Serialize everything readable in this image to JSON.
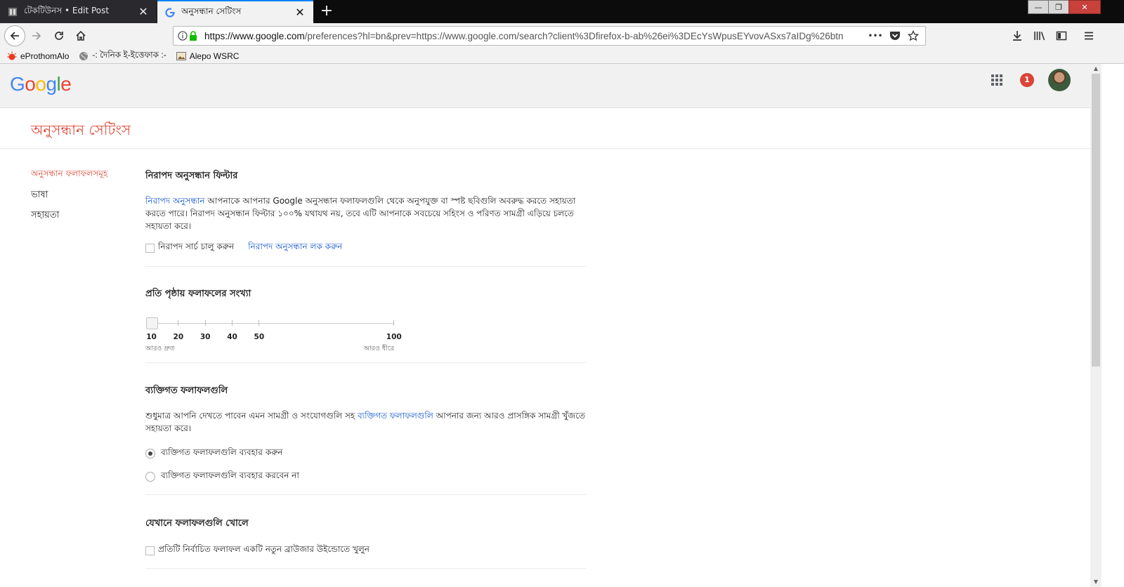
{
  "browser": {
    "tabs": [
      {
        "title": "টেকটিউনস • Edit Post",
        "icon": "book-icon",
        "active": false
      },
      {
        "title": "অনুসন্ধান সেটিংস",
        "icon": "google-g-icon",
        "active": true
      }
    ],
    "new_tab": "+",
    "window_controls": {
      "minimize": "—",
      "maximize": "❐",
      "close": "✕"
    },
    "url": {
      "host": "https://www.google.com",
      "path": "/preferences?hl=bn&prev=https://www.google.com/search?client%3Dfirefox-b-ab%26ei%3DEcYsWpusEYvovASxs7aIDg%26btn"
    },
    "url_actions": {
      "more": "•••"
    },
    "bookmarks": [
      {
        "label": "eProthomAlo",
        "icon": "sun-icon"
      },
      {
        "label": "-: দৈনিক ই-ইত্তেফাক :-",
        "icon": "globe-icon"
      },
      {
        "label": "Alepo WSRC",
        "icon": "image-icon"
      }
    ]
  },
  "google": {
    "logo": {
      "G": "G",
      "o1": "o",
      "o2": "o",
      "g": "g",
      "l": "l",
      "e": "e"
    },
    "notification_count": "1",
    "colors": {
      "blue": "#4285f4",
      "red": "#ea4335",
      "yellow": "#fbbc05",
      "green": "#34a853",
      "title_red": "#dd4b39",
      "link": "#1155cc"
    }
  },
  "page": {
    "title": "অনুসন্ধান সেটিংস",
    "nav": [
      "অনুসন্ধান ফলাফলসমূহ",
      "ভাষা",
      "সহায়তা"
    ],
    "safe_search": {
      "heading": "নিরাপদ অনুসন্ধান ফিল্টার",
      "link_text": "নিরাপদ অনুসন্ধান",
      "desc_line1": " আপনাকে আপনার Google অনুসন্ধান ফলাফলগুলি থেকে অনুপযুক্ত বা স্পষ্ট ছবিগুলি অবরুদ্ধ করতে সহায়তা",
      "desc_line2": "করতে পারে। নিরাপদ অনুসন্ধান ফিল্টার ১০০% যথাযথ নয়, তবে এটি আপনাকে সবচেয়ে সহিংস ও পরিণত সামগ্রী এড়িয়ে চলতে",
      "desc_line3": "সহায়তা করে।",
      "checkbox_label": "নিরাপদ সার্চ চালু করুন",
      "lock_link": "নিরাপদ অনুসন্ধান লক করুন"
    },
    "results_per_page": {
      "heading": "প্রতি পৃষ্ঠায় ফলাফলের সংখ্যা",
      "ticks": [
        "10",
        "20",
        "30",
        "40",
        "50",
        "100"
      ],
      "selected": 10,
      "faster": "আরও দ্রুত",
      "slower": "আরও ধীরে"
    },
    "personal": {
      "heading": "ব্যক্তিগত ফলাফলগুলি",
      "desc_pre": "শুধুমাত্র আপনি দেখতে পাবেন এমন সামগ্রী ও সংযোগগুলি সহ ",
      "desc_link": "ব্যক্তিগত ফলাফলগুলি",
      "desc_post": " আপনার জন্য আরও প্রাসঙ্গিক সামগ্রী খুঁজতে",
      "desc_line2": "সহায়তা করে।",
      "option_use": "ব্যক্তিগত ফলাফলগুলি ব্যবহার করুন",
      "option_dont": "ব্যক্তিগত ফলাফলগুলি ব্যবহার করবেন না",
      "selected": "use"
    },
    "open_results": {
      "heading": "যেখানে ফলাফলগুলি খোলে",
      "checkbox_label": "প্রতিটি নির্বাচিত ফলাফল একটি নতুন ব্রাউজার উইন্ডোতে খুলুন"
    }
  }
}
